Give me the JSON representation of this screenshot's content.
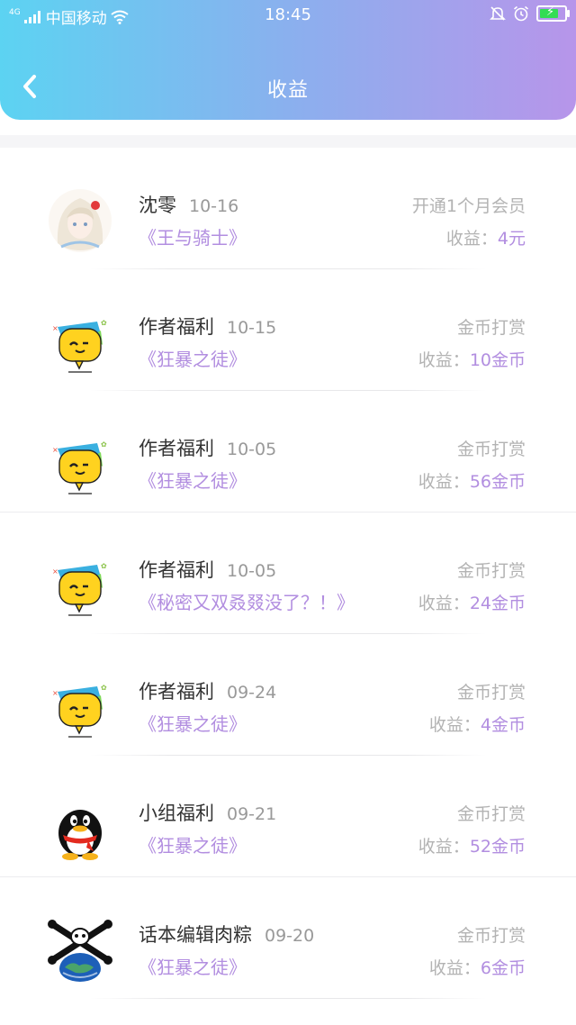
{
  "status_bar": {
    "network": "4G",
    "carrier": "中国移动",
    "time": "18:45",
    "battery_charging": true,
    "battery_level": 0.85,
    "icons": [
      "signal-icon",
      "wifi-icon",
      "bell-icon",
      "alarm-icon",
      "battery-icon"
    ]
  },
  "header": {
    "title": "收益",
    "back_icon": "chevron-left-icon",
    "gradient": [
      "#5cd3f2",
      "#b795ea"
    ]
  },
  "earnings": [
    {
      "avatar": "anime-girl",
      "name": "沈零",
      "date": "10-16",
      "book": "《王与骑士》",
      "type": "开通1个月会员",
      "earn_label": "收益：",
      "earn_amount": "4元"
    },
    {
      "avatar": "yellow-chat-bubble",
      "name": "作者福利",
      "date": "10-15",
      "book": "《狂暴之徒》",
      "type": "金币打赏",
      "earn_label": "收益：",
      "earn_amount": "10金币"
    },
    {
      "avatar": "yellow-chat-bubble",
      "name": "作者福利",
      "date": "10-05",
      "book": "《狂暴之徒》",
      "type": "金币打赏",
      "earn_label": "收益：",
      "earn_amount": "56金币"
    },
    {
      "avatar": "yellow-chat-bubble",
      "name": "作者福利",
      "date": "10-05",
      "book": "《秘密又双叒叕没了？！》",
      "type": "金币打赏",
      "earn_label": "收益：",
      "earn_amount": "24金币"
    },
    {
      "avatar": "yellow-chat-bubble",
      "name": "作者福利",
      "date": "09-24",
      "book": "《狂暴之徒》",
      "type": "金币打赏",
      "earn_label": "收益：",
      "earn_amount": "4金币"
    },
    {
      "avatar": "penguin",
      "name": "小组福利",
      "date": "09-21",
      "book": "《狂暴之徒》",
      "type": "金币打赏",
      "earn_label": "收益：",
      "earn_amount": "52金币"
    },
    {
      "avatar": "globe-skull",
      "name": "话本编辑肉粽",
      "date": "09-20",
      "book": "《狂暴之徒》",
      "type": "金币打赏",
      "earn_label": "收益：",
      "earn_amount": "6金币"
    }
  ],
  "colors": {
    "accent": "#b28ee0",
    "muted": "#b3b3b3",
    "text": "#333333"
  }
}
